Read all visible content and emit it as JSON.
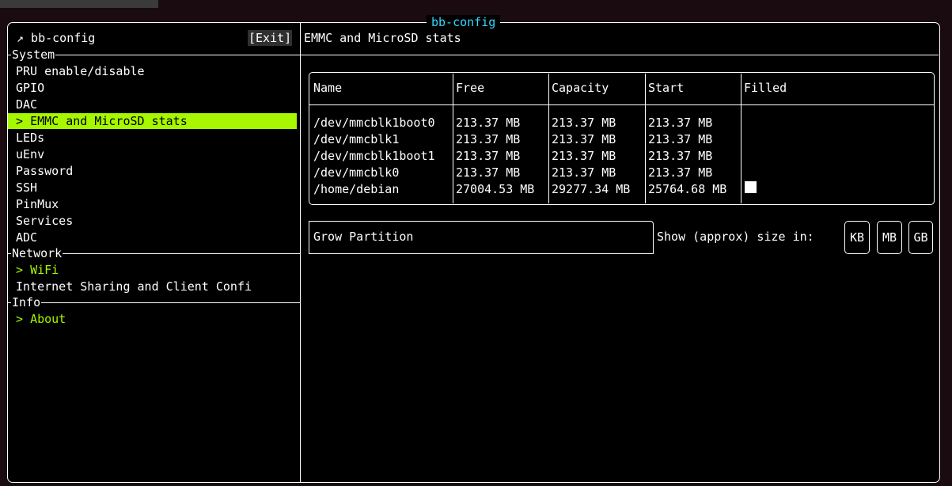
{
  "window": {
    "title": "bb-config"
  },
  "sidebar": {
    "header": "↗ bb-config",
    "exit_label": "[Exit]",
    "sections": [
      {
        "label": "System",
        "items": [
          "PRU enable/disable",
          "GPIO",
          "DAC",
          "EMMC and MicroSD stats",
          "LEDs",
          "uEnv",
          "Password",
          "SSH",
          "PinMux",
          "Services",
          "ADC"
        ]
      },
      {
        "label": "Network",
        "items": [
          "WiFi",
          "Internet Sharing and Client Confi"
        ]
      },
      {
        "label": "Info",
        "items": [
          "About"
        ]
      }
    ],
    "selected_item": "EMMC and MicroSD stats",
    "cursor_marker": ">"
  },
  "main": {
    "heading": "EMMC and MicroSD stats",
    "table": {
      "columns": [
        "Name",
        "Free",
        "Capacity",
        "Start",
        "Filled"
      ],
      "rows": [
        [
          "/dev/mmcblk1boot0",
          "213.37 MB",
          "213.37 MB",
          "213.37 MB",
          ""
        ],
        [
          "/dev/mmcblk1",
          "213.37 MB",
          "213.37 MB",
          "213.37 MB",
          ""
        ],
        [
          "/dev/mmcblk1boot1",
          "213.37 MB",
          "213.37 MB",
          "213.37 MB",
          ""
        ],
        [
          "/dev/mmcblk0",
          "213.37 MB",
          "213.37 MB",
          "213.37 MB",
          ""
        ],
        [
          "/home/debian",
          "27004.53 MB",
          "29277.34 MB",
          "25764.68 MB",
          ""
        ]
      ]
    },
    "grow_partition_label": "Grow Partition",
    "size_prompt": "Show (approx) size in:",
    "units": [
      "KB",
      "MB",
      "GB"
    ]
  },
  "colors": {
    "accent": "#a6f700",
    "title": "#33d6ff",
    "background": "#000000"
  }
}
